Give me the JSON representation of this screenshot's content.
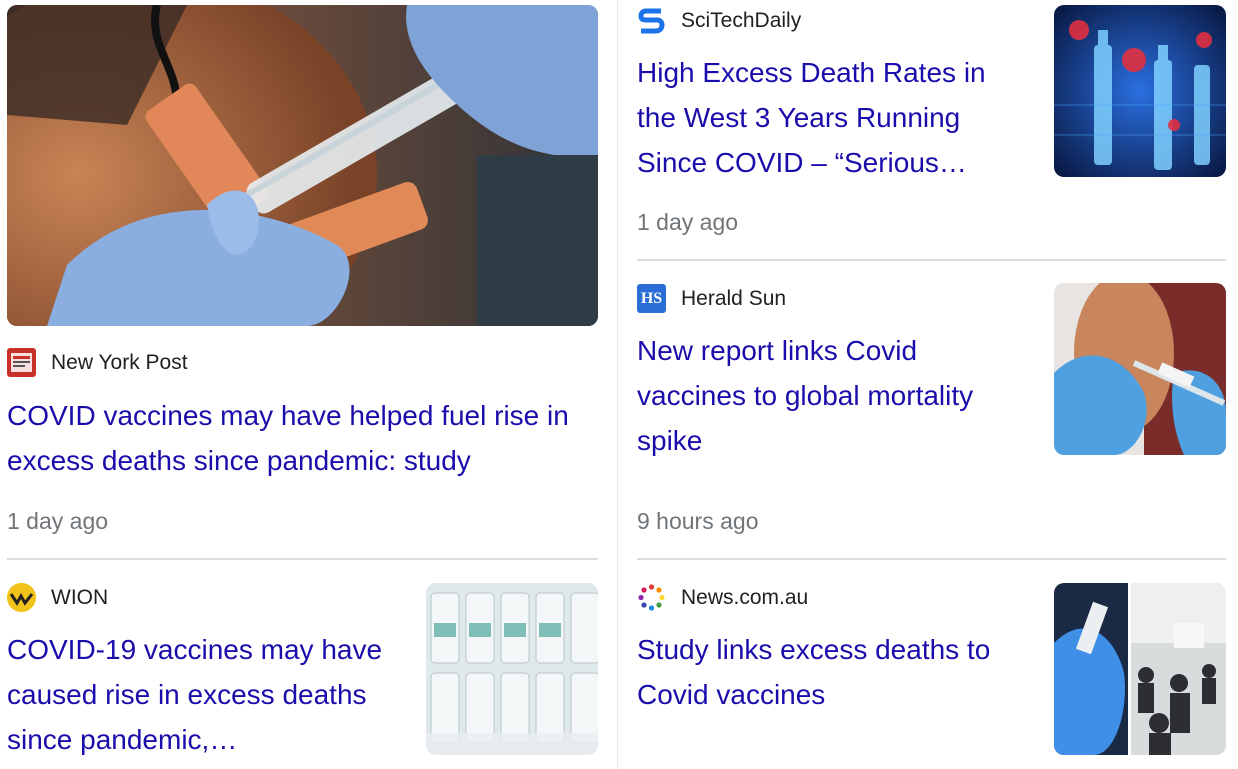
{
  "articles": [
    {
      "source": "New York Post",
      "source_icon": "new-york-post-logo-icon",
      "headline": "COVID vaccines may have helped fuel rise in excess deaths since pandemic: study",
      "time": "1 day ago",
      "image": "arm-vaccine-injection-photo"
    },
    {
      "source": "SciTechDaily",
      "source_icon": "scitechdaily-logo-icon",
      "headline": "High Excess Death Rates in the West 3 Years Running Since COVID – “Serious…",
      "time": "1 day ago",
      "image": "vaccine-vials-virus-illustration"
    },
    {
      "source": "Herald Sun",
      "source_icon": "herald-sun-logo-icon",
      "logo_text": "HS",
      "headline": "New report links Covid vaccines to global mortality spike",
      "time": "9 hours ago",
      "image": "arm-vaccine-injection-photo"
    },
    {
      "source": "WION",
      "source_icon": "wion-logo-icon",
      "headline": "COVID-19 vaccines may have caused rise in excess deaths since pandemic,…",
      "image": "vaccine-vials-photo"
    },
    {
      "source": "News.com.au",
      "source_icon": "news-com-au-logo-icon",
      "headline": "Study links excess deaths to Covid vaccines",
      "image": "vaccination-clinic-collage-photo"
    }
  ],
  "colors": {
    "link": "#1a0dab",
    "source_text": "#202124",
    "time_text": "#70757a",
    "divider": "#dadce0"
  }
}
